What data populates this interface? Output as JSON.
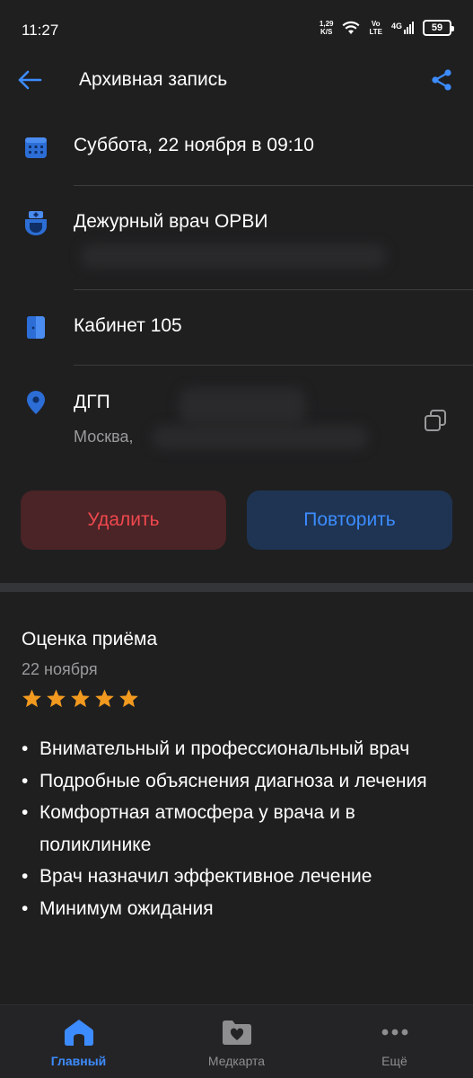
{
  "status_bar": {
    "time": "11:27",
    "net_speed_value": "1,29",
    "net_speed_unit": "K/S",
    "volte_top": "Vo",
    "volte_bottom": "LTE",
    "network": "4G",
    "battery": "59"
  },
  "header": {
    "title": "Архивная запись"
  },
  "appointment": {
    "datetime": "Суббота, 22 ноября в 09:10",
    "doctor": "Дежурный врач ОРВИ",
    "room": "Кабинет 105",
    "clinic_name": "ДГП",
    "clinic_address": "Москва,"
  },
  "actions": {
    "delete_label": "Удалить",
    "repeat_label": "Повторить"
  },
  "review": {
    "title": "Оценка приёма",
    "date": "22 ноября",
    "rating": 5,
    "items": [
      "Внимательный и профессиональный врач",
      "Подробные объяснения диагноза и лечения",
      "Комфортная атмосфера у врача и в поликлинике",
      "Врач назначил эффективное лечение",
      "Минимум ожидания"
    ]
  },
  "bottom_nav": {
    "items": [
      {
        "label": "Главный",
        "icon": "home-icon",
        "active": true
      },
      {
        "label": "Медкарта",
        "icon": "medcard-icon",
        "active": false
      },
      {
        "label": "Ещё",
        "icon": "more-icon",
        "active": false
      }
    ]
  },
  "colors": {
    "background": "#1f1f20",
    "accent": "#3d8cff",
    "danger": "#f0484e",
    "star": "#f29a1f"
  }
}
